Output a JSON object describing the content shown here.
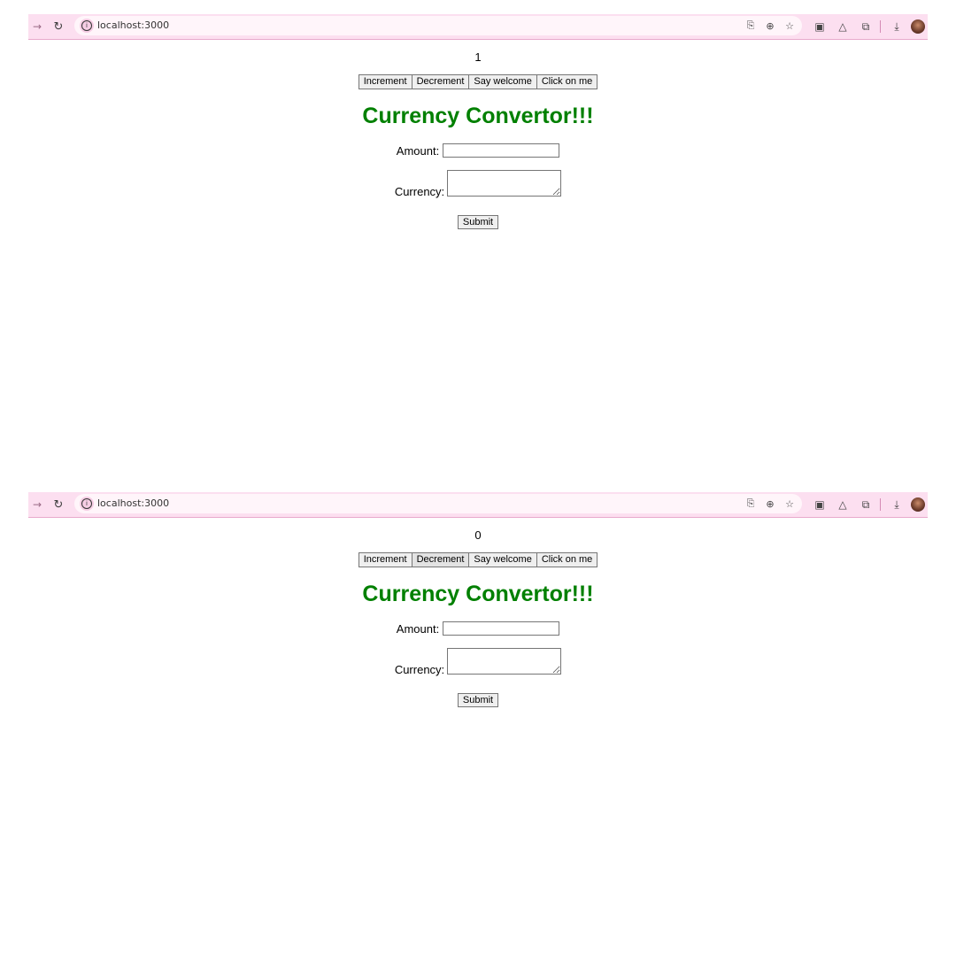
{
  "browser": {
    "url": "localhost:3000",
    "back_icon": "→",
    "reload_icon": "↻"
  },
  "screens": [
    {
      "count": "1",
      "buttons": [
        "Increment",
        "Decrement",
        "Say welcome",
        "Click on me"
      ],
      "title": "Currency Convertor!!!",
      "amount_label": "Amount:",
      "currency_label": "Currency:",
      "submit_label": "Submit"
    },
    {
      "count": "0",
      "buttons": [
        "Increment",
        "Decrement",
        "Say welcome",
        "Click on me"
      ],
      "title": "Currency Convertor!!!",
      "amount_label": "Amount:",
      "currency_label": "Currency:",
      "submit_label": "Submit"
    }
  ],
  "colors": {
    "title": "#008000",
    "toolbar": "#fcdff0"
  }
}
